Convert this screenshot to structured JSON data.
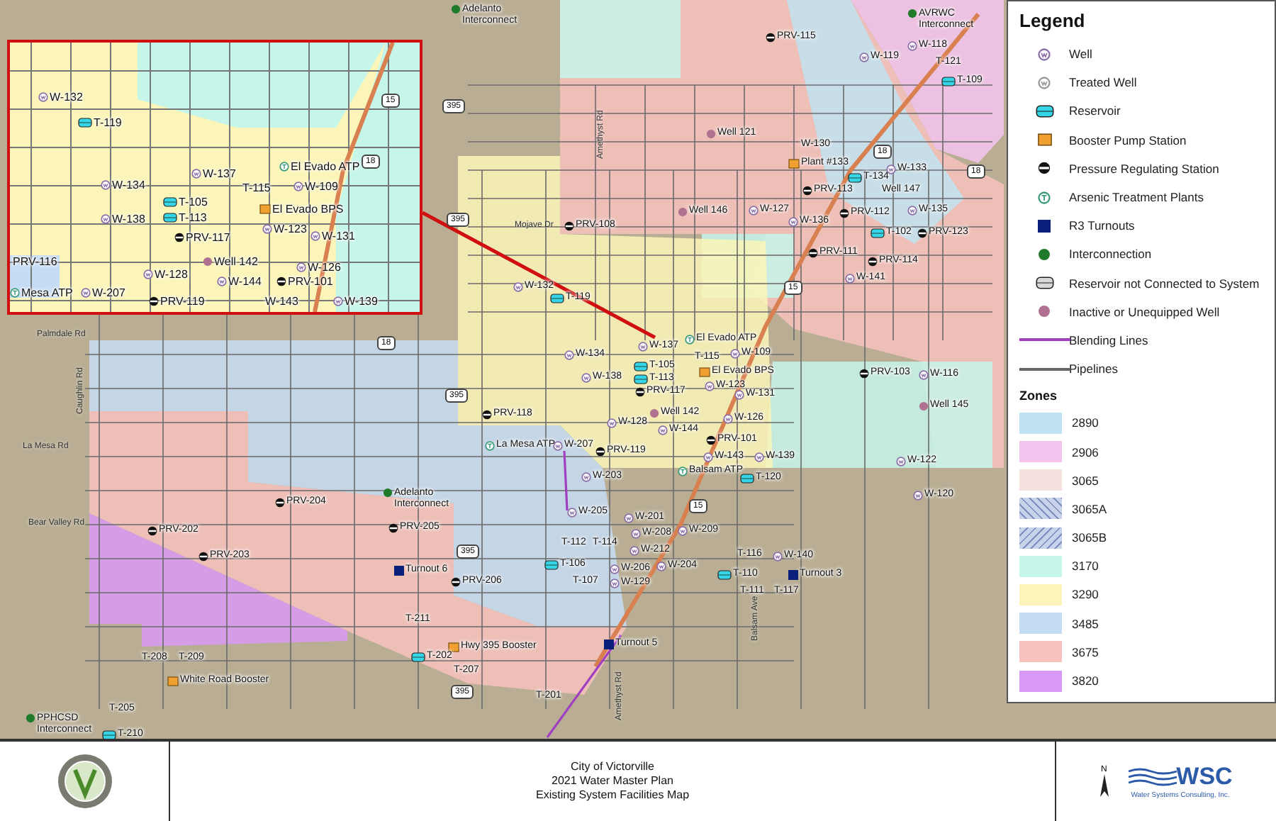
{
  "map": {
    "features": [
      {
        "kind": "interconnect",
        "label": "Adelanto Interconnect"
      },
      {
        "kind": "prv",
        "label": "PRV-115"
      },
      {
        "kind": "interconnect",
        "label": "AVRWC Interconnect"
      },
      {
        "kind": "well",
        "label": "W-118"
      },
      {
        "kind": "well",
        "label": "W-119"
      },
      {
        "kind": "label",
        "label": "T-121"
      },
      {
        "kind": "reservoir",
        "label": "T-109"
      },
      {
        "kind": "inactive",
        "label": "Well 121"
      },
      {
        "kind": "label",
        "label": "W-130"
      },
      {
        "kind": "booster",
        "label": "Plant #133"
      },
      {
        "kind": "reservoir",
        "label": "T-134"
      },
      {
        "kind": "well",
        "label": "W-133"
      },
      {
        "kind": "prv",
        "label": "PRV-113"
      },
      {
        "kind": "label",
        "label": "Well 147"
      },
      {
        "kind": "inactive",
        "label": "Well 146"
      },
      {
        "kind": "well",
        "label": "W-127"
      },
      {
        "kind": "prv",
        "label": "PRV-112"
      },
      {
        "kind": "well",
        "label": "W-135"
      },
      {
        "kind": "reservoir",
        "label": "T-102"
      },
      {
        "kind": "prv",
        "label": "PRV-123"
      },
      {
        "kind": "well",
        "label": "W-136"
      },
      {
        "kind": "road",
        "label": "Mojave Dr"
      },
      {
        "kind": "prv",
        "label": "PRV-108"
      },
      {
        "kind": "prv",
        "label": "PRV-111"
      },
      {
        "kind": "prv",
        "label": "PRV-114"
      },
      {
        "kind": "well",
        "label": "W-141"
      },
      {
        "kind": "well",
        "label": "W-132"
      },
      {
        "kind": "reservoir",
        "label": "T-119"
      },
      {
        "kind": "road-v",
        "label": "Amethyst Rd"
      },
      {
        "kind": "shield",
        "label": "395"
      },
      {
        "kind": "shield",
        "label": "395"
      },
      {
        "kind": "shield",
        "label": "18"
      },
      {
        "kind": "shield",
        "label": "15"
      },
      {
        "kind": "shield",
        "label": "18"
      },
      {
        "kind": "atp",
        "label": "El Evado ATP"
      },
      {
        "kind": "well",
        "label": "W-134"
      },
      {
        "kind": "well",
        "label": "W-137"
      },
      {
        "kind": "well",
        "label": "W-109"
      },
      {
        "kind": "reservoir",
        "label": "T-105"
      },
      {
        "kind": "label",
        "label": "T-115"
      },
      {
        "kind": "reservoir",
        "label": "T-113"
      },
      {
        "kind": "booster",
        "label": "El Evado BPS"
      },
      {
        "kind": "well",
        "label": "W-138"
      },
      {
        "kind": "prv",
        "label": "PRV-117"
      },
      {
        "kind": "well",
        "label": "W-123"
      },
      {
        "kind": "well",
        "label": "W-131"
      },
      {
        "kind": "inactive",
        "label": "Well 142"
      },
      {
        "kind": "well",
        "label": "W-126"
      },
      {
        "kind": "well",
        "label": "W-128"
      },
      {
        "kind": "well",
        "label": "W-144"
      },
      {
        "kind": "prv",
        "label": "PRV-101"
      },
      {
        "kind": "prv",
        "label": "PRV-119"
      },
      {
        "kind": "well",
        "label": "W-143"
      },
      {
        "kind": "well",
        "label": "W-139"
      },
      {
        "kind": "atp",
        "label": "Balsam ATP"
      },
      {
        "kind": "reservoir",
        "label": "T-120"
      },
      {
        "kind": "prv",
        "label": "PRV-103"
      },
      {
        "kind": "well",
        "label": "W-116"
      },
      {
        "kind": "inactive",
        "label": "Well 145"
      },
      {
        "kind": "well",
        "label": "W-122"
      },
      {
        "kind": "well",
        "label": "W-120"
      },
      {
        "kind": "prv",
        "label": "PRV-118"
      },
      {
        "kind": "atp",
        "label": "La Mesa ATP"
      },
      {
        "kind": "well",
        "label": "W-207"
      },
      {
        "kind": "well",
        "label": "W-203"
      },
      {
        "kind": "well",
        "label": "W-205"
      },
      {
        "kind": "well",
        "label": "W-201"
      },
      {
        "kind": "well",
        "label": "W-208"
      },
      {
        "kind": "well",
        "label": "W-209"
      },
      {
        "kind": "well",
        "label": "W-212"
      },
      {
        "kind": "well",
        "label": "W-204"
      },
      {
        "kind": "label",
        "label": "T-112"
      },
      {
        "kind": "label",
        "label": "T-114"
      },
      {
        "kind": "reservoir",
        "label": "T-106"
      },
      {
        "kind": "label",
        "label": "T-107"
      },
      {
        "kind": "well",
        "label": "W-206"
      },
      {
        "kind": "well",
        "label": "W-129"
      },
      {
        "kind": "label",
        "label": "T-116"
      },
      {
        "kind": "well",
        "label": "W-140"
      },
      {
        "kind": "reservoir",
        "label": "T-110"
      },
      {
        "kind": "label",
        "label": "T-111"
      },
      {
        "kind": "label",
        "label": "T-117"
      },
      {
        "kind": "turnout",
        "label": "Turnout 3"
      },
      {
        "kind": "turnout",
        "label": "Turnout 5"
      },
      {
        "kind": "road-v",
        "label": "Balsam Ave"
      },
      {
        "kind": "road",
        "label": "Palmdale Rd"
      },
      {
        "kind": "road-v",
        "label": "Caughlin Rd"
      },
      {
        "kind": "road",
        "label": "La Mesa Rd"
      },
      {
        "kind": "road",
        "label": "Bear Valley Rd"
      },
      {
        "kind": "prv",
        "label": "PRV-204"
      },
      {
        "kind": "interconnect",
        "label": "Adelanto Interconnect"
      },
      {
        "kind": "prv",
        "label": "PRV-202"
      },
      {
        "kind": "prv",
        "label": "PRV-205"
      },
      {
        "kind": "prv",
        "label": "PRV-203"
      },
      {
        "kind": "turnout",
        "label": "Turnout 6"
      },
      {
        "kind": "prv",
        "label": "PRV-206"
      },
      {
        "kind": "label",
        "label": "T-211"
      },
      {
        "kind": "booster",
        "label": "Hwy 395 Booster"
      },
      {
        "kind": "reservoir",
        "label": "T-202"
      },
      {
        "kind": "label",
        "label": "T-207"
      },
      {
        "kind": "label",
        "label": "T-208"
      },
      {
        "kind": "label",
        "label": "T-209"
      },
      {
        "kind": "booster",
        "label": "White Road Booster"
      },
      {
        "kind": "label",
        "label": "T-205"
      },
      {
        "kind": "interconnect",
        "label": "PPHCSD Interconnect"
      },
      {
        "kind": "reservoir",
        "label": "T-210"
      },
      {
        "kind": "label",
        "label": "T-201"
      },
      {
        "kind": "road-v",
        "label": "Amethyst Rd"
      },
      {
        "kind": "shield",
        "label": "18"
      },
      {
        "kind": "shield",
        "label": "395"
      },
      {
        "kind": "shield",
        "label": "395"
      },
      {
        "kind": "shield",
        "label": "395"
      },
      {
        "kind": "shield",
        "label": "15"
      }
    ],
    "inset_features": [
      {
        "kind": "well",
        "label": "W-132"
      },
      {
        "kind": "reservoir",
        "label": "T-119"
      },
      {
        "kind": "shield",
        "label": "15"
      },
      {
        "kind": "shield",
        "label": "18"
      },
      {
        "kind": "atp",
        "label": "El Evado ATP"
      },
      {
        "kind": "well",
        "label": "W-134"
      },
      {
        "kind": "well",
        "label": "W-137"
      },
      {
        "kind": "label",
        "label": "T-115"
      },
      {
        "kind": "well",
        "label": "W-109"
      },
      {
        "kind": "reservoir",
        "label": "T-105"
      },
      {
        "kind": "booster",
        "label": "El Evado BPS"
      },
      {
        "kind": "reservoir",
        "label": "T-113"
      },
      {
        "kind": "well",
        "label": "W-138"
      },
      {
        "kind": "well",
        "label": "W-123"
      },
      {
        "kind": "well",
        "label": "W-131"
      },
      {
        "kind": "prv",
        "label": "PRV-117"
      },
      {
        "kind": "inactive",
        "label": "Well 142"
      },
      {
        "kind": "well",
        "label": "W-126"
      },
      {
        "kind": "well",
        "label": "W-128"
      },
      {
        "kind": "well",
        "label": "W-144"
      },
      {
        "kind": "label",
        "label": "PRV-116"
      },
      {
        "kind": "prv",
        "label": "PRV-101"
      },
      {
        "kind": "atp",
        "label": "Mesa ATP"
      },
      {
        "kind": "well",
        "label": "W-207"
      },
      {
        "kind": "prv",
        "label": "PRV-119"
      },
      {
        "kind": "label",
        "label": "W-143"
      },
      {
        "kind": "well",
        "label": "W-139"
      }
    ]
  },
  "legend": {
    "title": "Legend",
    "items": [
      {
        "kind": "well",
        "label": "Well"
      },
      {
        "kind": "treated-well",
        "label": "Treated Well"
      },
      {
        "kind": "reservoir",
        "label": "Reservoir"
      },
      {
        "kind": "booster",
        "label": "Booster Pump Station"
      },
      {
        "kind": "prv",
        "label": "Pressure Regulating Station"
      },
      {
        "kind": "atp",
        "label": "Arsenic Treatment Plants"
      },
      {
        "kind": "turnout",
        "label": "R3 Turnouts"
      },
      {
        "kind": "interconnect",
        "label": "Interconnection"
      },
      {
        "kind": "reservoir-nc",
        "label": "Reservoir not Connected to System"
      },
      {
        "kind": "inactive",
        "label": "Inactive or Unequipped Well"
      },
      {
        "kind": "blending-line",
        "label": "Blending Lines"
      },
      {
        "kind": "pipeline",
        "label": "Pipelines"
      }
    ],
    "zones_title": "Zones",
    "zones": [
      {
        "label": "2890",
        "color": "#bfe3f2",
        "kind": "solid"
      },
      {
        "label": "2906",
        "color": "#f5c4ee",
        "kind": "solid"
      },
      {
        "label": "3065",
        "color": "#f7e1de",
        "kind": "solid"
      },
      {
        "label": "3065A",
        "color": "#c8d2ea",
        "kind": "hatch-up"
      },
      {
        "label": "3065B",
        "color": "#c8d2ea",
        "kind": "hatch-down"
      },
      {
        "label": "3170",
        "color": "#c6f5ea",
        "kind": "solid"
      },
      {
        "label": "3290",
        "color": "#fbf5b9",
        "kind": "solid"
      },
      {
        "label": "3485",
        "color": "#c5dcf5",
        "kind": "solid"
      },
      {
        "label": "3675",
        "color": "#f7c2bd",
        "kind": "solid"
      },
      {
        "label": "3820",
        "color": "#d99af5",
        "kind": "solid"
      }
    ]
  },
  "title_block": {
    "lines": [
      "City of Victorville",
      "2021 Water Master Plan",
      "Existing System Facilities Map"
    ],
    "north": "N",
    "company": "WSC",
    "company_name": "Water Systems Consulting, Inc."
  }
}
